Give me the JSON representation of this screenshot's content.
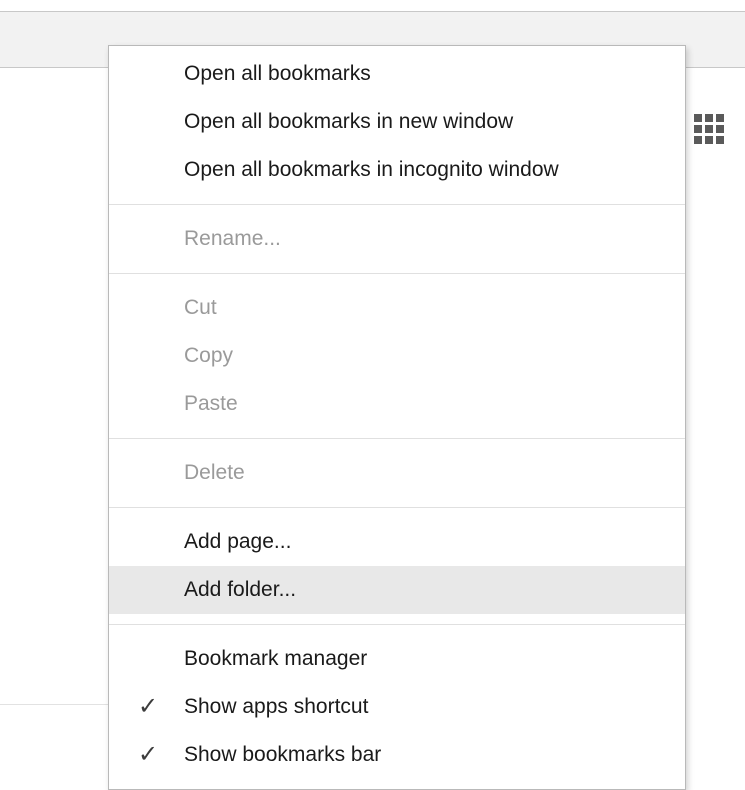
{
  "menu": {
    "groups": [
      {
        "items": [
          {
            "label": "Open all bookmarks",
            "enabled": true
          },
          {
            "label": "Open all bookmarks in new window",
            "enabled": true
          },
          {
            "label": "Open all bookmarks in incognito window",
            "enabled": true
          }
        ]
      },
      {
        "items": [
          {
            "label": "Rename...",
            "enabled": false
          }
        ]
      },
      {
        "items": [
          {
            "label": "Cut",
            "enabled": false
          },
          {
            "label": "Copy",
            "enabled": false
          },
          {
            "label": "Paste",
            "enabled": false
          }
        ]
      },
      {
        "items": [
          {
            "label": "Delete",
            "enabled": false
          }
        ]
      },
      {
        "items": [
          {
            "label": "Add page...",
            "enabled": true
          },
          {
            "label": "Add folder...",
            "enabled": true,
            "highlighted": true
          }
        ]
      },
      {
        "items": [
          {
            "label": "Bookmark manager",
            "enabled": true
          },
          {
            "label": "Show apps shortcut",
            "enabled": true,
            "checked": true
          },
          {
            "label": "Show bookmarks bar",
            "enabled": true,
            "checked": true
          }
        ]
      }
    ]
  },
  "icons": {
    "apps": "apps-grid-icon",
    "check": "checkmark-icon",
    "check_glyph": "✓"
  },
  "colors": {
    "toolbar_bg": "#f2f2f2",
    "menu_text": "#1a1a1a",
    "disabled_text": "#9a9a9a",
    "highlight_bg": "#e8e8e8"
  }
}
